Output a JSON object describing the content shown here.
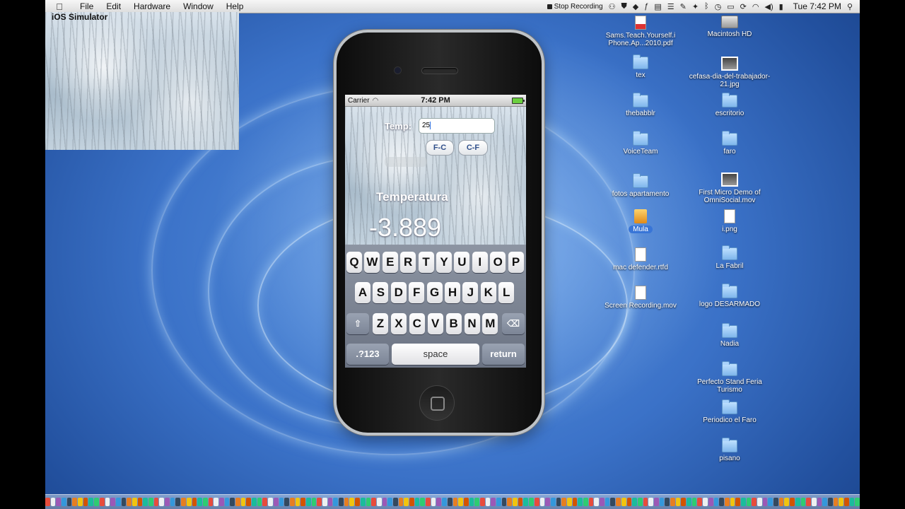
{
  "menubar": {
    "apple": "",
    "app_name": "iOS Simulator",
    "items": [
      "File",
      "Edit",
      "Hardware",
      "Window",
      "Help"
    ],
    "stop_recording": "Stop Recording",
    "clock": "Tue 7:42 PM"
  },
  "device": {
    "status": {
      "carrier": "Carrier",
      "time": "7:42 PM"
    },
    "app": {
      "temp_label": "Temp:",
      "temp_value": "25",
      "fc_label": "F-C",
      "cf_label": "C-F",
      "title": "Temperatura",
      "result": "-3.889"
    },
    "keyboard": {
      "row1": [
        "Q",
        "W",
        "E",
        "R",
        "T",
        "Y",
        "U",
        "I",
        "O",
        "P"
      ],
      "row2": [
        "A",
        "S",
        "D",
        "F",
        "G",
        "H",
        "J",
        "K",
        "L"
      ],
      "row3": [
        "Z",
        "X",
        "C",
        "V",
        "B",
        "N",
        "M"
      ],
      "shift": "⇧",
      "delete": "⌫",
      "numbers": ".?123",
      "space": "space",
      "return": "return"
    }
  },
  "desktop_icons": [
    {
      "label": "Sams.Teach.Yourself.i Phone.Ap...2010.pdf",
      "kind": "pdf"
    },
    {
      "label": "Macintosh HD",
      "kind": "hd"
    },
    {
      "label": "tex",
      "kind": "folder"
    },
    {
      "label": "cefasa-dia-del-trabajador-21.jpg",
      "kind": "img"
    },
    {
      "label": "thebabblr",
      "kind": "folder"
    },
    {
      "label": "escritorio",
      "kind": "folder"
    },
    {
      "label": "VoiceTeam",
      "kind": "folder"
    },
    {
      "label": "faro",
      "kind": "folder"
    },
    {
      "label": "fotos apartamento",
      "kind": "folder"
    },
    {
      "label": "First Micro Demo of OmniSocial.mov",
      "kind": "img"
    },
    {
      "label": "Mula",
      "kind": "mula"
    },
    {
      "label": "i.png",
      "kind": "doc"
    },
    {
      "label": "mac defender.rtfd",
      "kind": "doc"
    },
    {
      "label": "La Fabril",
      "kind": "folder"
    },
    {
      "label": "Screen Recording.mov",
      "kind": "doc"
    },
    {
      "label": "logo DESARMADO",
      "kind": "folder"
    },
    {
      "label": "Nadia",
      "kind": "folder"
    },
    {
      "label": "Perfecto Stand Feria Turismo",
      "kind": "folder"
    },
    {
      "label": "Periodico el Faro",
      "kind": "folder"
    },
    {
      "label": "pisano",
      "kind": "folder"
    }
  ],
  "colors": {
    "desktop_blue": "#3b72c8",
    "selection_blue": "#3875d7",
    "button_text": "#304f8a"
  }
}
